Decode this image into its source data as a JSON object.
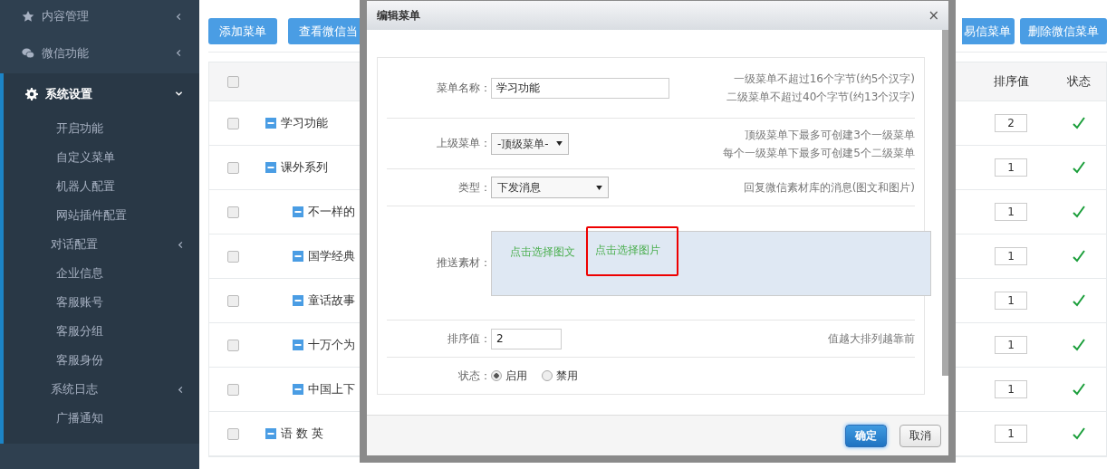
{
  "sidebar": {
    "items": [
      {
        "label": "内容管理",
        "kind": "star",
        "expanded": false
      },
      {
        "label": "微信功能",
        "kind": "wechat",
        "expanded": false
      },
      {
        "label": "系统设置",
        "kind": "gear",
        "expanded": true,
        "children": [
          {
            "label": "开启功能"
          },
          {
            "label": "自定义菜单"
          },
          {
            "label": "机器人配置"
          },
          {
            "label": "网站插件配置"
          },
          {
            "label": "对话配置",
            "expanded": false
          },
          {
            "label": "企业信息"
          },
          {
            "label": "客服账号"
          },
          {
            "label": "客服分组"
          },
          {
            "label": "客服身份"
          },
          {
            "label": "系统日志",
            "expanded": false
          },
          {
            "label": "广播通知"
          }
        ]
      }
    ]
  },
  "toolbar": {
    "left_buttons": [
      "添加菜单",
      "查看微信当"
    ],
    "right_buttons": [
      "易信菜单",
      "删除微信菜单"
    ]
  },
  "table": {
    "header_checked": false,
    "columns": [
      "排序值",
      "状态"
    ],
    "rows": [
      {
        "name": "学习功能",
        "checked": false,
        "sort": "2",
        "enabled": true
      },
      {
        "name": "课外系列",
        "checked": false,
        "sort": "1",
        "enabled": true,
        "children": [
          {
            "name": "不一样的",
            "checked": false,
            "sort": "1",
            "enabled": true
          },
          {
            "name": "国学经典",
            "checked": false,
            "sort": "1",
            "enabled": true
          },
          {
            "name": "童话故事",
            "checked": false,
            "sort": "1",
            "enabled": true
          },
          {
            "name": "十万个为",
            "checked": false,
            "sort": "1",
            "enabled": true
          },
          {
            "name": "中国上下",
            "checked": false,
            "sort": "1",
            "enabled": true
          }
        ]
      },
      {
        "name": "语 数 英",
        "checked": false,
        "sort": "1",
        "enabled": true
      }
    ]
  },
  "dialog": {
    "title": "编辑菜单",
    "close": "×",
    "fields": [
      {
        "kind": "input",
        "label": "菜单名称：",
        "value": "学习功能",
        "hints": [
          "一级菜单不超过16个字节(约5个汉字)",
          "二级菜单不超过40个字节(约13个汉字)"
        ]
      },
      {
        "kind": "select",
        "label": "上级菜单：",
        "value": "-顶级菜单-",
        "hints": [
          "顶级菜单下最多可创建3个一级菜单",
          "每个一级菜单下最多可创建5个二级菜单"
        ]
      },
      {
        "kind": "select-wide",
        "label": "类型：",
        "value": "下发消息",
        "hints": [
          "回复微信素材库的消息(图文和图片)"
        ]
      },
      {
        "kind": "material",
        "label": "推送素材：",
        "links": [
          {
            "label": "点击选择图文",
            "highlighted": false
          },
          {
            "label": "点击选择图片",
            "highlighted": true
          }
        ]
      },
      {
        "kind": "input-short",
        "label": "排序值：",
        "value": "2",
        "hints": [
          "值越大排列越靠前"
        ]
      },
      {
        "kind": "radio",
        "label": "状态：",
        "options": [
          {
            "label": "启用",
            "selected": true
          },
          {
            "label": "禁用",
            "selected": false
          }
        ]
      }
    ],
    "buttons": [
      {
        "label": "确定",
        "primary": true
      },
      {
        "label": "取消",
        "primary": false
      }
    ]
  }
}
